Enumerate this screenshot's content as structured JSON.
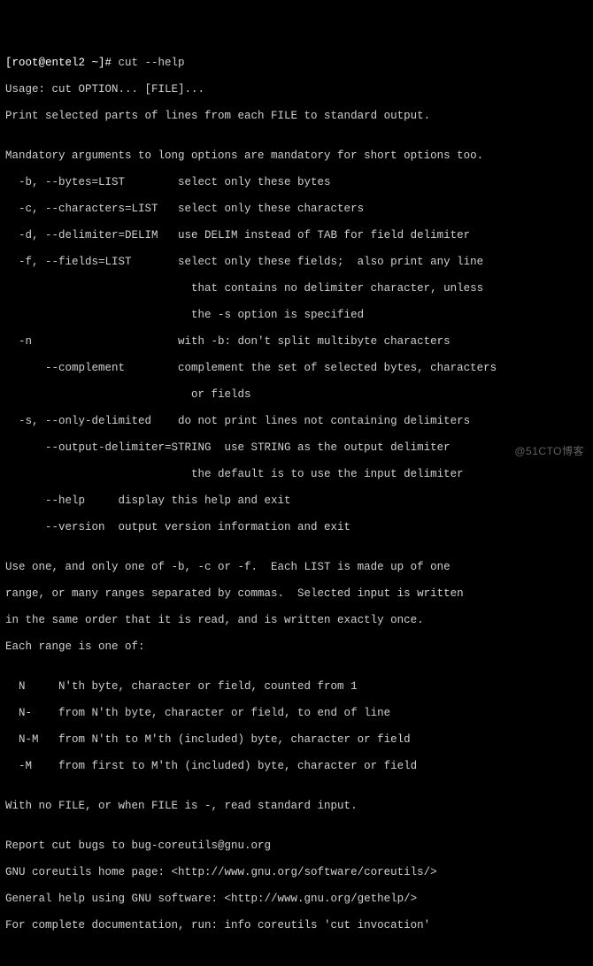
{
  "prompt": {
    "user_host": "[root@entel2 ~]#",
    "command": " cut --help"
  },
  "lines": {
    "l01": "Usage: cut OPTION... [FILE]...",
    "l02": "Print selected parts of lines from each FILE to standard output.",
    "l03": "",
    "l04": "Mandatory arguments to long options are mandatory for short options too.",
    "l05": "  -b, --bytes=LIST        select only these bytes",
    "l06": "  -c, --characters=LIST   select only these characters",
    "l07": "  -d, --delimiter=DELIM   use DELIM instead of TAB for field delimiter",
    "l08": "  -f, --fields=LIST       select only these fields;  also print any line",
    "l09": "                            that contains no delimiter character, unless",
    "l10": "                            the -s option is specified",
    "l11": "  -n                      with -b: don't split multibyte characters",
    "l12": "      --complement        complement the set of selected bytes, characters",
    "l13": "                            or fields",
    "l14": "  -s, --only-delimited    do not print lines not containing delimiters",
    "l15": "      --output-delimiter=STRING  use STRING as the output delimiter",
    "l16": "                            the default is to use the input delimiter",
    "l17": "      --help     display this help and exit",
    "l18": "      --version  output version information and exit",
    "l19": "",
    "l20": "Use one, and only one of -b, -c or -f.  Each LIST is made up of one",
    "l21": "range, or many ranges separated by commas.  Selected input is written",
    "l22": "in the same order that it is read, and is written exactly once.",
    "l23": "Each range is one of:",
    "l24": "",
    "l25": "  N     N'th byte, character or field, counted from 1",
    "l26": "  N-    from N'th byte, character or field, to end of line",
    "l27": "  N-M   from N'th to M'th (included) byte, character or field",
    "l28": "  -M    from first to M'th (included) byte, character or field",
    "l29": "",
    "l30": "With no FILE, or when FILE is -, read standard input.",
    "l31": "",
    "l32": "Report cut bugs to bug-coreutils@gnu.org",
    "l33": "GNU coreutils home page: <http://www.gnu.org/software/coreutils/>",
    "l34": "General help using GNU software: <http://www.gnu.org/gethelp/>",
    "l35": "For complete documentation, run: info coreutils 'cut invocation'"
  },
  "watermark": "@51CTO博客"
}
